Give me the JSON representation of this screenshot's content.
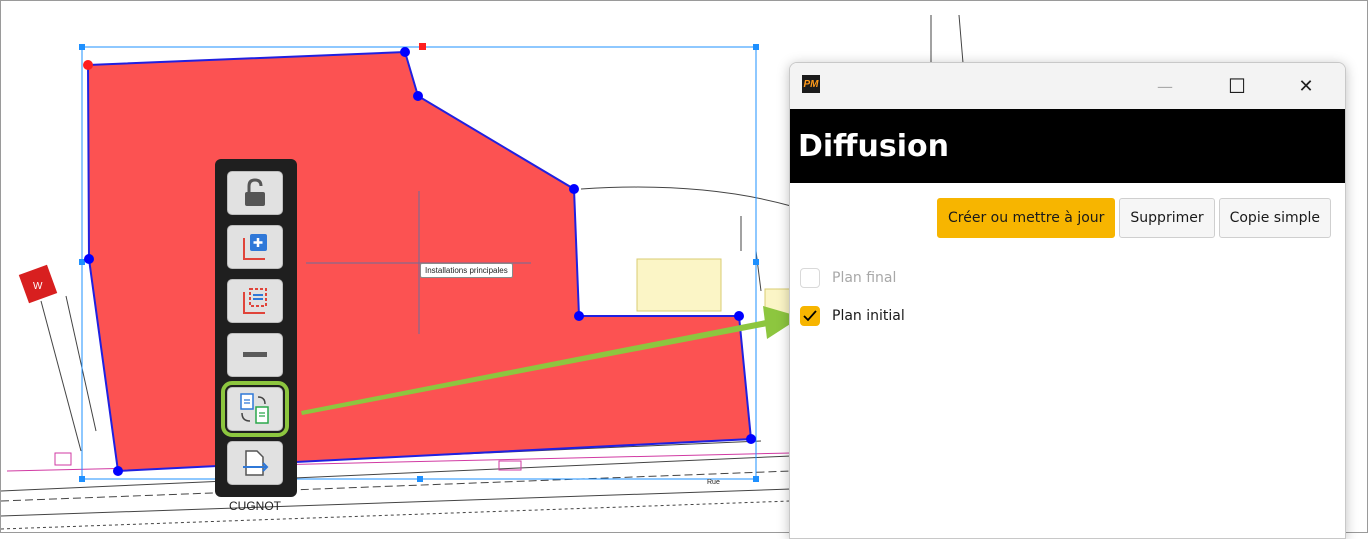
{
  "canvas": {
    "tooltip": "Installations principales",
    "street_label": "CUGNOT",
    "street_label_small": "Rue",
    "polygon_color": "#fc5252",
    "selection_color": "#1e90ff",
    "vertex_color": "#0000ff",
    "arrow_color": "#8dc63f"
  },
  "toolbar": {
    "buttons": [
      {
        "name": "unlock",
        "icon": "padlock-open-icon"
      },
      {
        "name": "add",
        "icon": "add-layer-icon"
      },
      {
        "name": "select-area",
        "icon": "dashed-selection-icon"
      },
      {
        "name": "remove",
        "icon": "minus-icon"
      },
      {
        "name": "diffusion",
        "icon": "document-sync-icon",
        "selected": true
      },
      {
        "name": "export",
        "icon": "document-arrow-icon"
      }
    ]
  },
  "window": {
    "app_icon": "PM",
    "minimize": "—",
    "maximize": "☐",
    "close": "✕",
    "title": "Diffusion",
    "buttons": {
      "create": "Créer ou mettre à jour",
      "delete": "Supprimer",
      "copy": "Copie simple"
    },
    "options": [
      {
        "label": "Plan final",
        "checked": false
      },
      {
        "label": "Plan initial",
        "checked": true
      }
    ]
  }
}
